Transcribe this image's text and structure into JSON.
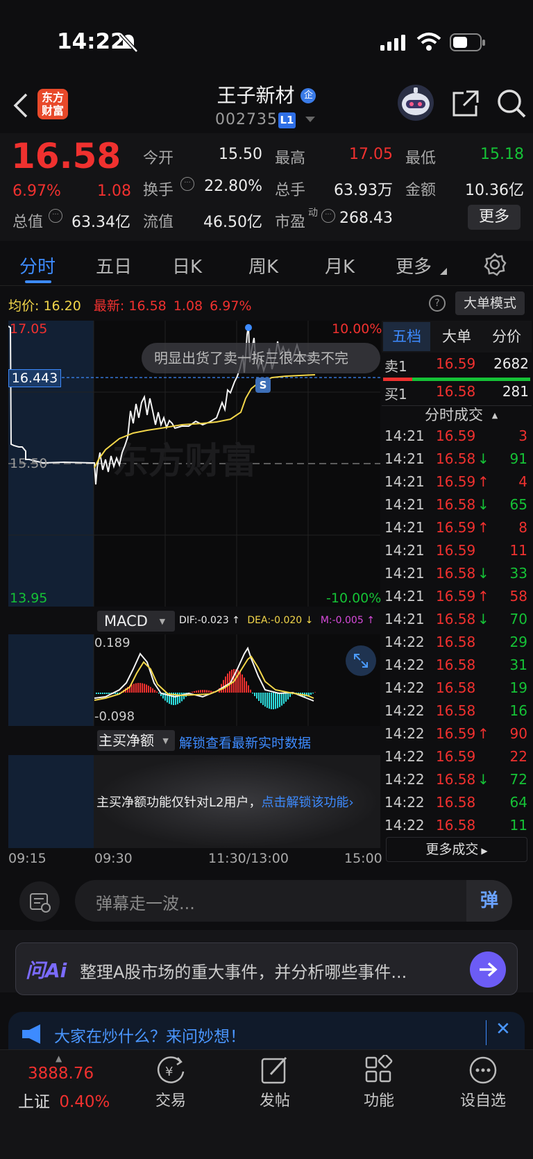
{
  "status_bar": {
    "time": "14:22"
  },
  "header": {
    "logo_text": "东方\n财富",
    "logo_line1": "东方",
    "logo_line2": "财富",
    "stock_name": "王子新材",
    "enterprise_badge": "企",
    "stock_code": "002735",
    "level_badge": "L1"
  },
  "quote": {
    "price": "16.58",
    "change_pct": "6.97%",
    "change": "1.08",
    "open_label": "今开",
    "open": "15.50",
    "high_label": "最高",
    "high": "17.05",
    "low_label": "最低",
    "low": "15.18",
    "turnover_label": "换手",
    "turnover": "22.80%",
    "volume_label": "总手",
    "volume": "63.93万",
    "amount_label": "金额",
    "amount": "10.36亿",
    "total_cap_label": "总值",
    "total_cap": "63.34亿",
    "float_cap_label": "流值",
    "float_cap": "46.50亿",
    "pe_label": "市盈",
    "pe_sup": "动",
    "pe": "268.43",
    "more_button": "更多"
  },
  "tabs": [
    "分时",
    "五日",
    "日K",
    "周K",
    "月K",
    "更多"
  ],
  "active_tab": "分时",
  "chart_info": {
    "avg_label": "均价:",
    "avg": "16.20",
    "latest_label": "最新:",
    "latest": "16.58",
    "latest_change": "1.08",
    "latest_pct": "6.97%",
    "big_order_button": "大单模式",
    "y_high": "17.05",
    "y_mid": "15.50",
    "y_low": "13.95",
    "pct_high": "10.00%",
    "pct_low": "-10.00%",
    "crosshair_value": "16.443",
    "danmaku_text": "明显出货了卖一拆三很本卖不完",
    "sell_marker": "S",
    "watermark": "东方财富"
  },
  "macd": {
    "selector": "MACD",
    "dif": "DIF:-0.023 ↑",
    "dea": "DEA:-0.020 ↓",
    "m": "M:-0.005 ↑",
    "max": "0.189",
    "min": "-0.098"
  },
  "net_buy": {
    "selector": "主买净额",
    "unlock_link": "解锁查看最新实时数据",
    "locked_text": "主买净额功能仅针对L2用户，",
    "locked_link": "点击解锁该功能"
  },
  "time_axis": [
    "09:15",
    "09:30",
    "11:30/13:00",
    "15:00"
  ],
  "side_panel": {
    "tabs": [
      "五档",
      "大单",
      "分价"
    ],
    "ask1_label": "卖1",
    "ask1_price": "16.59",
    "ask1_vol": "2682",
    "bid1_label": "买1",
    "bid1_price": "16.58",
    "bid1_vol": "281",
    "ticks_title": "分时成交",
    "ticks": [
      {
        "time": "14:21",
        "price": "16.59",
        "arrow": "",
        "vol": "3",
        "color": "red"
      },
      {
        "time": "14:21",
        "price": "16.58",
        "arrow": "↓",
        "vol": "91",
        "color": "green"
      },
      {
        "time": "14:21",
        "price": "16.59",
        "arrow": "↑",
        "vol": "4",
        "color": "red"
      },
      {
        "time": "14:21",
        "price": "16.58",
        "arrow": "↓",
        "vol": "65",
        "color": "green"
      },
      {
        "time": "14:21",
        "price": "16.59",
        "arrow": "↑",
        "vol": "8",
        "color": "red"
      },
      {
        "time": "14:21",
        "price": "16.59",
        "arrow": "",
        "vol": "11",
        "color": "red"
      },
      {
        "time": "14:21",
        "price": "16.58",
        "arrow": "↓",
        "vol": "33",
        "color": "green"
      },
      {
        "time": "14:21",
        "price": "16.59",
        "arrow": "↑",
        "vol": "58",
        "color": "red"
      },
      {
        "time": "14:21",
        "price": "16.58",
        "arrow": "↓",
        "vol": "70",
        "color": "green"
      },
      {
        "time": "14:22",
        "price": "16.58",
        "arrow": "",
        "vol": "29",
        "color": "green"
      },
      {
        "time": "14:22",
        "price": "16.58",
        "arrow": "",
        "vol": "31",
        "color": "green"
      },
      {
        "time": "14:22",
        "price": "16.58",
        "arrow": "",
        "vol": "19",
        "color": "green"
      },
      {
        "time": "14:22",
        "price": "16.58",
        "arrow": "",
        "vol": "16",
        "color": "green"
      },
      {
        "time": "14:22",
        "price": "16.59",
        "arrow": "↑",
        "vol": "90",
        "color": "red"
      },
      {
        "time": "14:22",
        "price": "16.59",
        "arrow": "",
        "vol": "22",
        "color": "red"
      },
      {
        "time": "14:22",
        "price": "16.58",
        "arrow": "↓",
        "vol": "72",
        "color": "green"
      },
      {
        "time": "14:22",
        "price": "16.58",
        "arrow": "",
        "vol": "64",
        "color": "green"
      },
      {
        "time": "14:22",
        "price": "16.58",
        "arrow": "",
        "vol": "11",
        "color": "green"
      }
    ],
    "more_ticks": "更多成交"
  },
  "danmaku_input": {
    "placeholder": "弹幕走一波...",
    "button": "弹"
  },
  "ai_bar": {
    "logo": "问Ai",
    "prompt": "整理A股市场的重大事件，并分析哪些事件..."
  },
  "hot_bar": {
    "text": "大家在炒什么？来问妙想！"
  },
  "nav": {
    "index_value": "3888.76",
    "index_name": "上证",
    "index_pct": "0.40%",
    "items": [
      "交易",
      "发帖",
      "功能",
      "设自选"
    ]
  },
  "colors": {
    "up": "#f0312f",
    "down": "#15c236",
    "avg_line": "#f2d64a",
    "accent": "#3d8bff"
  }
}
